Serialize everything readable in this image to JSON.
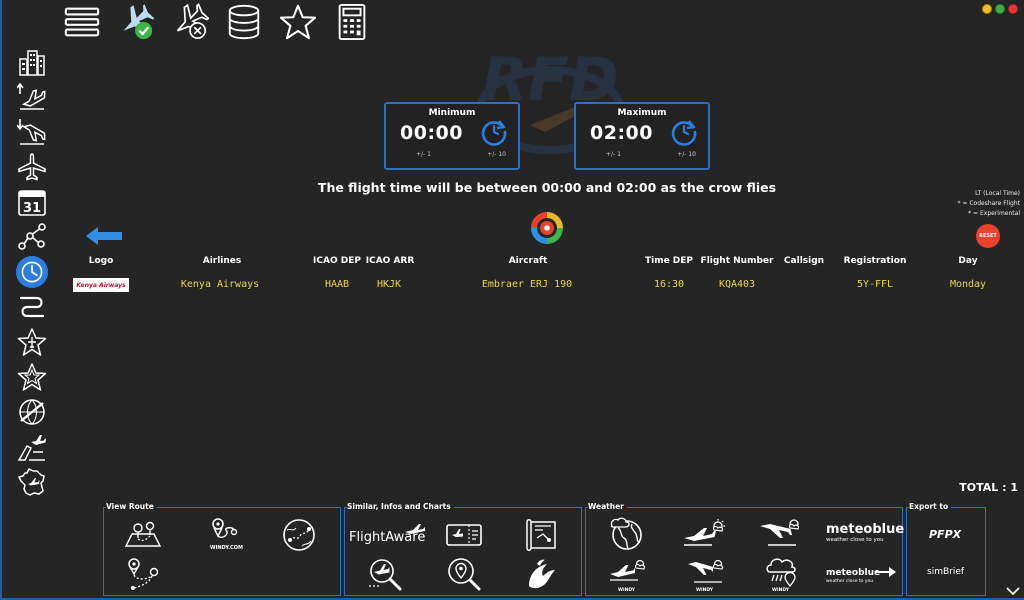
{
  "toolbar": {
    "items": [
      {
        "icon": "menu-icon"
      },
      {
        "icon": "flight-confirmed-icon"
      },
      {
        "icon": "flight-cancel-icon"
      },
      {
        "icon": "database-icon"
      },
      {
        "icon": "star-icon"
      },
      {
        "icon": "calculator-icon"
      }
    ]
  },
  "sidebar": {
    "items": [
      {
        "icon": "city-icon"
      },
      {
        "icon": "departure-icon"
      },
      {
        "icon": "arrival-icon"
      },
      {
        "icon": "airplane-icon"
      },
      {
        "icon": "calendar-icon",
        "label": "31"
      },
      {
        "icon": "network-icon"
      },
      {
        "icon": "clock-icon",
        "active": true
      },
      {
        "icon": "route-icon"
      },
      {
        "icon": "star-plane-icon"
      },
      {
        "icon": "star-outline-icon"
      },
      {
        "icon": "globe-plane-icon"
      },
      {
        "icon": "airport-icon"
      },
      {
        "icon": "france-map-icon"
      }
    ]
  },
  "time_filter": {
    "minimum": {
      "label": "Minimum",
      "value": "00:00",
      "step_small": "+/- 1",
      "step_large": "+/- 10"
    },
    "maximum": {
      "label": "Maximum",
      "value": "02:00",
      "step_small": "+/- 1",
      "step_large": "+/- 10"
    },
    "message": "The flight time will be between 00:00 and 02:00 as the crow flies"
  },
  "legend": {
    "line1": "LT (Local Time)",
    "line2": "* = Codeshare Flight",
    "line3": "* = Experimental"
  },
  "reset_label": "RESET",
  "table": {
    "headers": [
      "Logo",
      "Airlines",
      "ICAO DEP",
      "ICAO ARR",
      "Aircraft",
      "Time DEP",
      "Flight Number",
      "Callsign",
      "Registration",
      "Day"
    ],
    "rows": [
      {
        "logo": "Kenya Airways",
        "airline": "Kenya Airways",
        "icao_dep": "HAAB",
        "icao_arr": "HKJK",
        "aircraft": "Embraer ERJ 190",
        "time_dep": "16:30",
        "flight_number": "KQA403",
        "callsign": "",
        "registration": "5Y-FFL",
        "day": "Monday"
      }
    ]
  },
  "total": "TOTAL : 1",
  "panels": {
    "view_route": {
      "title": "View Route",
      "windy_label": "WINDY.COM"
    },
    "similar": {
      "title": "Similar, Infos and Charts",
      "flightaware": "FlightAware"
    },
    "weather": {
      "title": "Weather",
      "windy_label": "WINDY",
      "meteoblue": "meteoblue",
      "meteoblue_tag": "weather close to you"
    },
    "export": {
      "title": "Export to",
      "pfpx": "PFPX",
      "simbrief": "simBrief"
    }
  },
  "colors": {
    "background": "#252525",
    "accent_blue": "#2f6fc0",
    "active_blue": "#2b7de0",
    "data_yellow": "#e8d64a",
    "reset_red": "#e8412c"
  }
}
